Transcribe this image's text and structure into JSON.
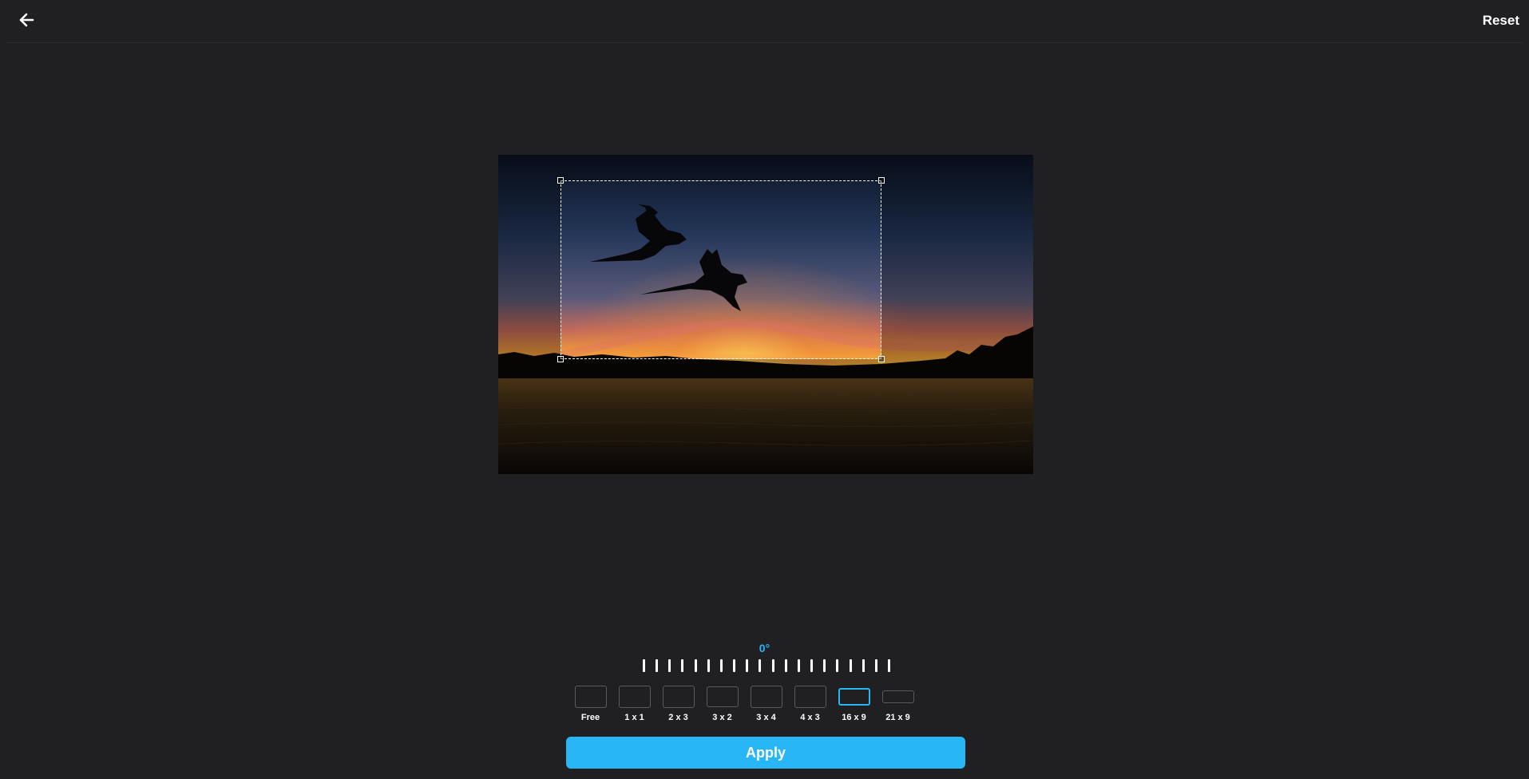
{
  "header": {
    "back_icon": "arrow-left-icon",
    "reset_label": "Reset"
  },
  "editor": {
    "image_alt": "Two parrots flying over water at sunset",
    "rotation_label": "0°",
    "rotation_degrees": 0,
    "ratios": [
      {
        "label": "Free",
        "active": false
      },
      {
        "label": "1 x 1",
        "active": false
      },
      {
        "label": "2 x 3",
        "active": false
      },
      {
        "label": "3 x 2",
        "active": false
      },
      {
        "label": "3 x 4",
        "active": false
      },
      {
        "label": "4 x 3",
        "active": false
      },
      {
        "label": "16 x 9",
        "active": true
      },
      {
        "label": "21 x 9",
        "active": false
      }
    ],
    "apply_label": "Apply"
  },
  "colors": {
    "background": "#202022",
    "accent": "#29b6f6"
  }
}
